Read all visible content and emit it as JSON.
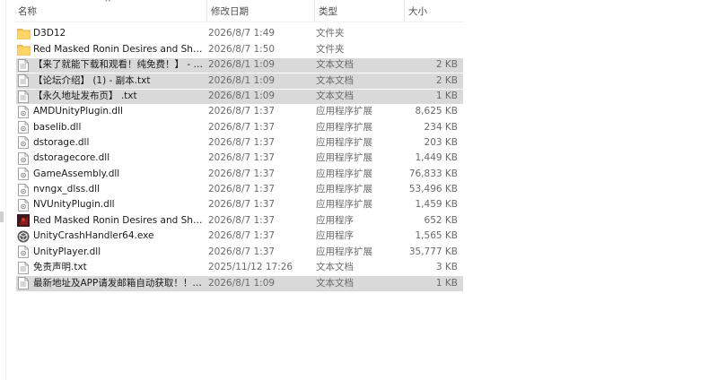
{
  "columns": {
    "name": "名称",
    "date": "修改日期",
    "type": "类型",
    "size": "大小",
    "sort_glyph": "^"
  },
  "files": [
    {
      "name": "D3D12",
      "date": "2026/8/7 1:49",
      "type": "文件夹",
      "size": "",
      "icon": "folder-icon",
      "selected": false
    },
    {
      "name": "Red Masked Ronin Desires and Shad...",
      "date": "2026/8/7 1:50",
      "type": "文件夹",
      "size": "",
      "icon": "folder-icon",
      "selected": false
    },
    {
      "name": "【来了就能下载和观看！纯免费！】 - 副...",
      "date": "2026/8/1 1:09",
      "type": "文本文档",
      "size": "2 KB",
      "icon": "text-file-icon",
      "selected": true
    },
    {
      "name": "【论坛介绍】 (1) - 副本.txt",
      "date": "2026/8/1 1:09",
      "type": "文本文档",
      "size": "2 KB",
      "icon": "text-file-icon",
      "selected": true
    },
    {
      "name": "【永久地址发布页】 .txt",
      "date": "2026/8/1 1:09",
      "type": "文本文档",
      "size": "1 KB",
      "icon": "text-file-icon",
      "selected": true
    },
    {
      "name": "AMDUnityPlugin.dll",
      "date": "2026/8/7 1:37",
      "type": "应用程序扩展",
      "size": "8,625 KB",
      "icon": "dll-file-icon",
      "selected": false
    },
    {
      "name": "baselib.dll",
      "date": "2026/8/7 1:37",
      "type": "应用程序扩展",
      "size": "234 KB",
      "icon": "dll-file-icon",
      "selected": false
    },
    {
      "name": "dstorage.dll",
      "date": "2026/8/7 1:37",
      "type": "应用程序扩展",
      "size": "203 KB",
      "icon": "dll-file-icon",
      "selected": false
    },
    {
      "name": "dstoragecore.dll",
      "date": "2026/8/7 1:37",
      "type": "应用程序扩展",
      "size": "1,449 KB",
      "icon": "dll-file-icon",
      "selected": false
    },
    {
      "name": "GameAssembly.dll",
      "date": "2026/8/7 1:37",
      "type": "应用程序扩展",
      "size": "76,833 KB",
      "icon": "dll-file-icon",
      "selected": false
    },
    {
      "name": "nvngx_dlss.dll",
      "date": "2026/8/7 1:37",
      "type": "应用程序扩展",
      "size": "53,496 KB",
      "icon": "dll-file-icon",
      "selected": false
    },
    {
      "name": "NVUnityPlugin.dll",
      "date": "2026/8/7 1:37",
      "type": "应用程序扩展",
      "size": "1,459 KB",
      "icon": "dll-file-icon",
      "selected": false
    },
    {
      "name": "Red Masked Ronin Desires and Shad...",
      "date": "2026/8/7 1:37",
      "type": "应用程序",
      "size": "652 KB",
      "icon": "game-app-icon",
      "selected": false
    },
    {
      "name": "UnityCrashHandler64.exe",
      "date": "2026/8/7 1:37",
      "type": "应用程序",
      "size": "1,565 KB",
      "icon": "unity-app-icon",
      "selected": false
    },
    {
      "name": "UnityPlayer.dll",
      "date": "2026/8/7 1:37",
      "type": "应用程序扩展",
      "size": "35,777 KB",
      "icon": "dll-file-icon",
      "selected": false
    },
    {
      "name": "免责声明.txt",
      "date": "2025/11/12 17:26",
      "type": "文本文档",
      "size": "3 KB",
      "icon": "text-file-icon",
      "selected": false
    },
    {
      "name": "最新地址及APP请发邮箱自动获取！！！...",
      "date": "2026/8/1 1:09",
      "type": "文本文档",
      "size": "1 KB",
      "icon": "text-file-icon",
      "selected": true
    }
  ],
  "colors": {
    "selection": "#d9d9d9",
    "folder": "#f5c451",
    "muted_text": "#6b6b6b"
  }
}
